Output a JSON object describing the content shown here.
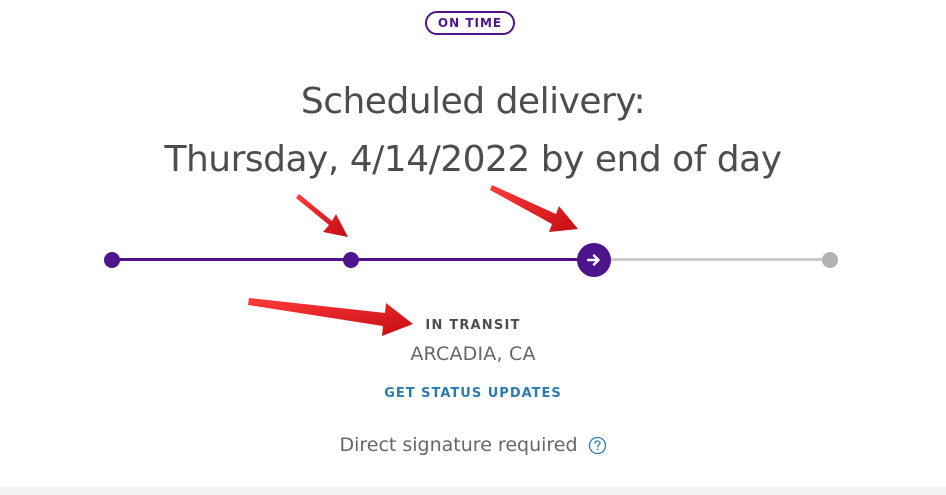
{
  "status_badge": "ON TIME",
  "delivery": {
    "heading": "Scheduled delivery:",
    "date_line": "Thursday, 4/14/2022 by end of day"
  },
  "progress": {
    "completed_steps": 2,
    "current_step": 3,
    "total_steps": 4,
    "completed_color": "#4d148c",
    "pending_color": "#cccccc"
  },
  "current_status": {
    "label": "IN TRANSIT",
    "location": "ARCADIA, CA"
  },
  "links": {
    "status_updates": "GET STATUS UPDATES"
  },
  "signature": {
    "text": "Direct signature required",
    "icon": "help-circle-icon"
  },
  "colors": {
    "brand_purple": "#4d148c",
    "link_blue": "#2a7cae",
    "annotation_red": "#e8141c"
  }
}
